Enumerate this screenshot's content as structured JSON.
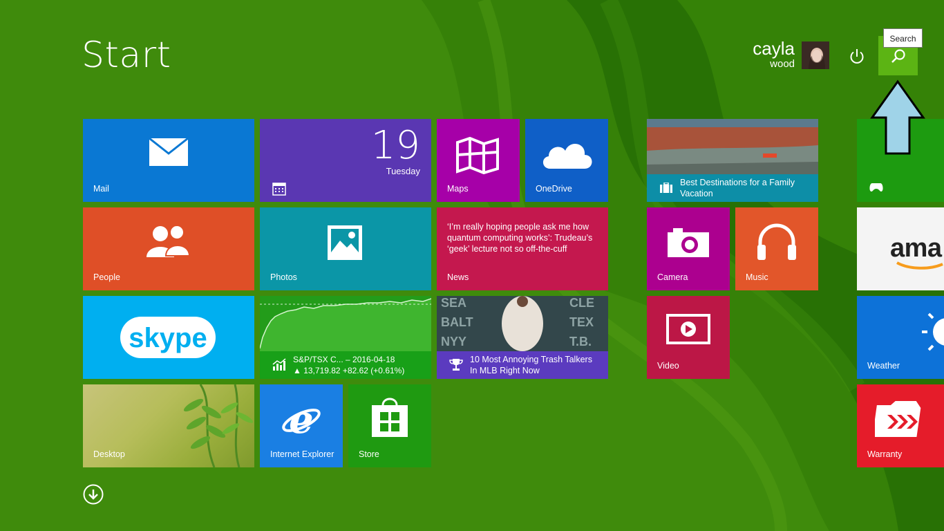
{
  "screen": {
    "title": "Start",
    "accent_color": "#5cb414",
    "background_color": "#3f8b0c"
  },
  "user": {
    "first_name": "cayla",
    "last_name": "wood"
  },
  "search": {
    "tooltip": "Search"
  },
  "tiles": {
    "mail": {
      "label": "Mail",
      "icon": "mail-icon"
    },
    "calendar": {
      "day": "19",
      "weekday": "Tuesday",
      "icon": "calendar-icon"
    },
    "maps": {
      "label": "Maps",
      "icon": "map-icon"
    },
    "onedrive": {
      "label": "OneDrive",
      "icon": "cloud-icon"
    },
    "travel": {
      "headline": "Best Destinations for a Family Vacation",
      "icon": "suitcase-icon"
    },
    "xbox": {
      "icon": "gamepad-icon"
    },
    "people": {
      "label": "People",
      "icon": "people-icon"
    },
    "photos": {
      "label": "Photos",
      "icon": "photo-icon"
    },
    "news": {
      "label": "News",
      "headline": "‘I’m really hoping people ask me how quantum computing works’: Trudeau’s ‘geek’ lecture not so off-the-cuff"
    },
    "camera": {
      "label": "Camera",
      "icon": "camera-icon"
    },
    "music": {
      "label": "Music",
      "icon": "headphones-icon"
    },
    "amazon": {
      "text": "ama"
    },
    "skype": {
      "text": "skype"
    },
    "finance": {
      "line1": "S&P/TSX C... – 2016-04-18",
      "line2": "▲ 13,719.82 +82.62 (+0.61%)",
      "icon": "chart-icon"
    },
    "sports": {
      "headline": "10 Most Annoying Trash Talkers In MLB Right Now",
      "icon": "trophy-icon"
    },
    "video": {
      "label": "Video",
      "icon": "play-icon"
    },
    "weather": {
      "label": "Weather",
      "icon": "sun-icon"
    },
    "desktop": {
      "label": "Desktop"
    },
    "ie": {
      "label": "Internet Explorer",
      "icon": "ie-icon"
    },
    "store": {
      "label": "Store",
      "icon": "store-icon"
    },
    "warranty": {
      "label": "Warranty",
      "icon": "folder-icon"
    }
  }
}
